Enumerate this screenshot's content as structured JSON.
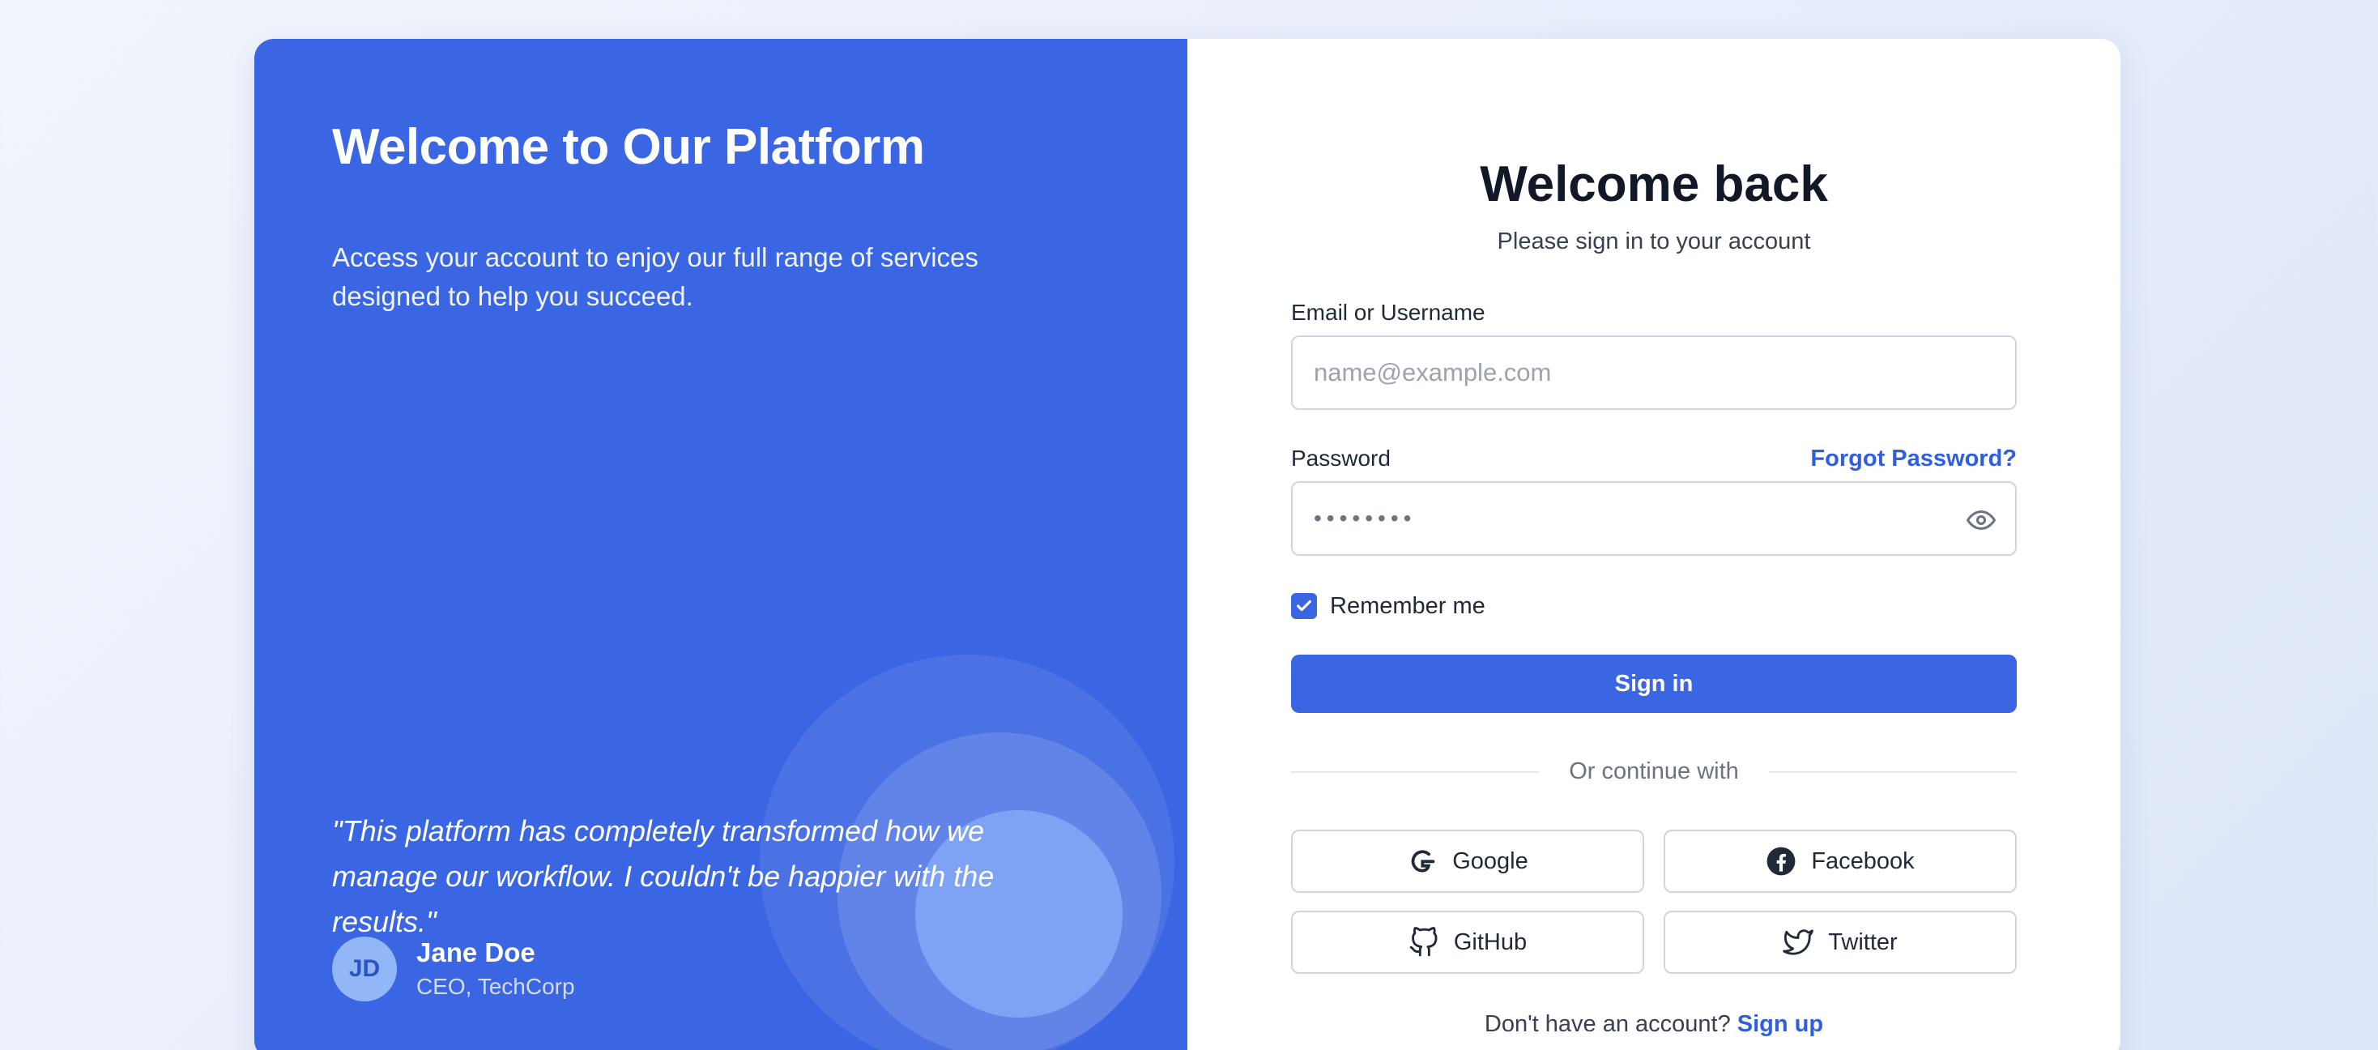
{
  "hero": {
    "title": "Welcome to Our Platform",
    "subtitle": "Access your account to enjoy our full range of services designed to help you succeed.",
    "quote": "\"This platform has completely transformed how we manage our workflow. I couldn't be happier with the results.\"",
    "author": {
      "initials": "JD",
      "name": "Jane Doe",
      "role": "CEO, TechCorp"
    }
  },
  "form": {
    "title": "Welcome back",
    "subtitle": "Please sign in to your account",
    "email_label": "Email or Username",
    "email_placeholder": "name@example.com",
    "password_label": "Password",
    "password_value": "••••••••",
    "forgot_label": "Forgot Password?",
    "remember_label": "Remember me",
    "remember_checked": true,
    "signin_label": "Sign in",
    "divider_label": "Or continue with",
    "social": [
      {
        "label": "Google",
        "icon": "google-icon"
      },
      {
        "label": "Facebook",
        "icon": "facebook-icon"
      },
      {
        "label": "GitHub",
        "icon": "github-icon"
      },
      {
        "label": "Twitter",
        "icon": "twitter-icon"
      }
    ],
    "signup_prompt": "Don't have an account?",
    "signup_label": "Sign up"
  },
  "colors": {
    "primary": "#3a65e3",
    "link": "#2f5ee0",
    "heading": "#111827",
    "border": "#d1d5db"
  }
}
